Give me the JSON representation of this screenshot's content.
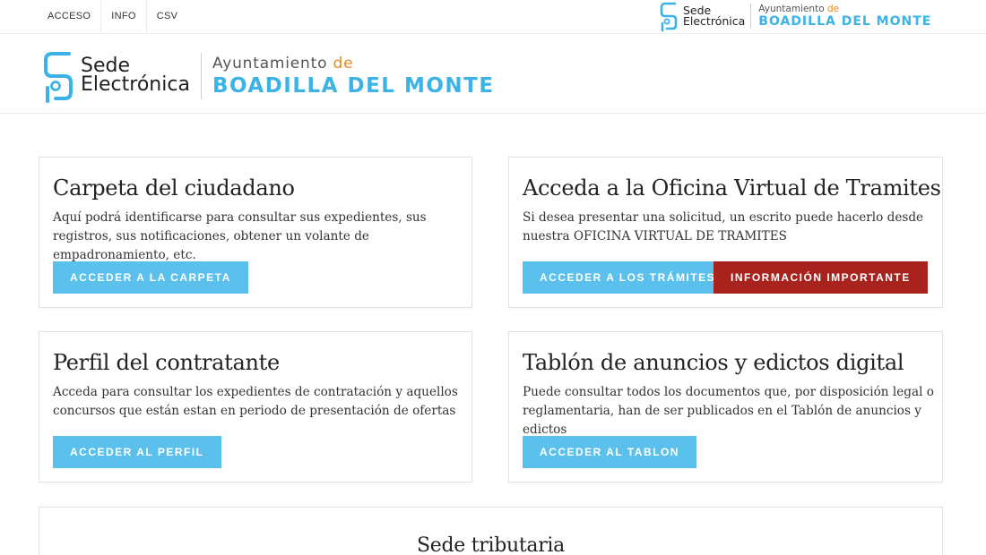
{
  "topnav": {
    "items": [
      "ACCESO",
      "INFO",
      "CSV"
    ]
  },
  "logo": {
    "sede_line1": "Sede",
    "sede_line2": "Electrónica",
    "ayuntamiento": "Ayuntamiento",
    "de": "de",
    "town": "BOADILLA DEL MONTE"
  },
  "colors": {
    "primary_button": "#5bc0eb",
    "important_button": "#a8231e",
    "brand_blue": "#3cb3e6"
  },
  "cards": [
    {
      "title": "Carpeta del ciudadano",
      "text": "Aquí podrá identificarse para consultar sus expedientes, sus registros, sus notificaciones, obtener un volante de empadronamiento, etc.",
      "button": "ACCEDER A LA CARPETA"
    },
    {
      "title": "Acceda a la Oficina Virtual de Tramites",
      "text": "Si desea presentar una solicitud, un escrito puede hacerlo desde nuestra OFICINA VIRTUAL DE TRAMITES",
      "button": "ACCEDER A LOS TRÁMITES",
      "button2": "INFORMACIÓN IMPORTANTE"
    },
    {
      "title": "Perfil del contratante",
      "text": "Acceda para consultar los expedientes de contratación y aquellos concursos que están estan en periodo de presentación de ofertas",
      "button": "ACCEDER AL PERFIL"
    },
    {
      "title": "Tablón de anuncios y edictos digital",
      "text": "Puede consultar todos los documentos que, por disposición legal o reglamentaria, han de ser publicados en el Tablón de anuncios y edictos",
      "button": "ACCEDER AL TABLON"
    },
    {
      "title": "Sede tributaria"
    }
  ]
}
